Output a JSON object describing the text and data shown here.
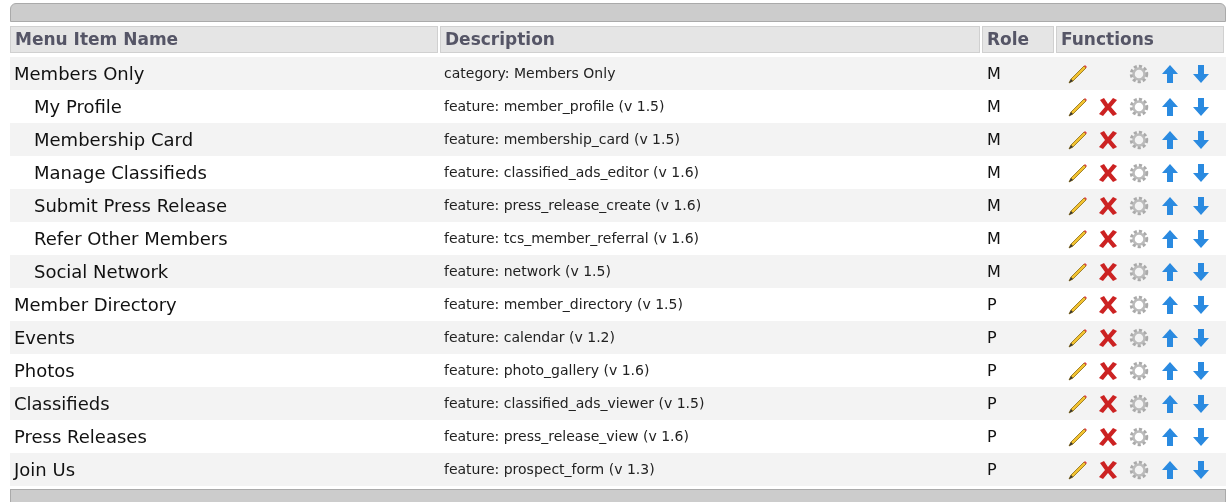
{
  "table": {
    "columns": [
      "Menu Item Name",
      "Description",
      "Role",
      "Functions"
    ],
    "rows": [
      {
        "name": "Members Only",
        "description": "category: Members Only",
        "role": "M",
        "deletable": false,
        "children": [
          {
            "name": "My Profile",
            "description": "feature: member_profile (v 1.5)",
            "role": "M",
            "deletable": true
          },
          {
            "name": "Membership Card",
            "description": "feature: membership_card (v 1.5)",
            "role": "M",
            "deletable": true
          },
          {
            "name": "Manage Classifieds",
            "description": "feature: classified_ads_editor (v 1.6)",
            "role": "M",
            "deletable": true
          },
          {
            "name": "Submit Press Release",
            "description": "feature: press_release_create (v 1.6)",
            "role": "M",
            "deletable": true
          },
          {
            "name": "Refer Other Members",
            "description": "feature: tcs_member_referral (v 1.6)",
            "role": "M",
            "deletable": true
          },
          {
            "name": "Social Network",
            "description": "feature: network (v 1.5)",
            "role": "M",
            "deletable": true
          }
        ]
      },
      {
        "name": "Member Directory",
        "description": "feature: member_directory (v 1.5)",
        "role": "P",
        "deletable": true
      },
      {
        "name": "Events",
        "description": "feature: calendar (v 1.2)",
        "role": "P",
        "deletable": true
      },
      {
        "name": "Photos",
        "description": "feature: photo_gallery (v 1.6)",
        "role": "P",
        "deletable": true
      },
      {
        "name": "Classifieds",
        "description": "feature: classified_ads_viewer (v 1.5)",
        "role": "P",
        "deletable": true
      },
      {
        "name": "Press Releases",
        "description": "feature: press_release_view (v 1.6)",
        "role": "P",
        "deletable": true
      },
      {
        "name": "Join Us",
        "description": "feature: prospect_form (v 1.3)",
        "role": "P",
        "deletable": true
      }
    ]
  }
}
